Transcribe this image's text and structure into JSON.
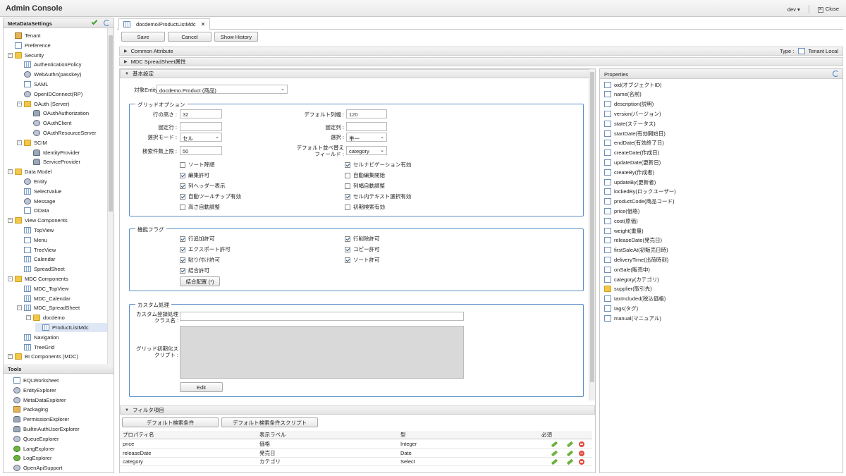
{
  "app": {
    "title": "Admin Console",
    "user": "dev",
    "close_label": "Close"
  },
  "left": {
    "header": "MetaDataSettings",
    "tree": [
      {
        "label": "Tenant",
        "depth": 0,
        "icon": "house-icon",
        "exp": ""
      },
      {
        "label": "Preference",
        "depth": 0,
        "icon": "doc-icon",
        "exp": ""
      },
      {
        "label": "Security",
        "depth": 0,
        "icon": "folder-icon",
        "exp": "-"
      },
      {
        "label": "AuthenticationPolicy",
        "depth": 1,
        "icon": "grid-icon",
        "exp": ""
      },
      {
        "label": "WebAuthn(passkey)",
        "depth": 1,
        "icon": "gear-icon",
        "exp": ""
      },
      {
        "label": "SAML",
        "depth": 1,
        "icon": "doc-icon",
        "exp": ""
      },
      {
        "label": "OpenIDConnect(RP)",
        "depth": 1,
        "icon": "gear-icon",
        "exp": ""
      },
      {
        "label": "OAuth (Server)",
        "depth": 1,
        "icon": "folder-icon",
        "exp": "-"
      },
      {
        "label": "OAuthAuthorization",
        "depth": 2,
        "icon": "person-icon",
        "exp": ""
      },
      {
        "label": "OAuthClient",
        "depth": 2,
        "icon": "gear-icon",
        "exp": ""
      },
      {
        "label": "OAuthResourceServer",
        "depth": 2,
        "icon": "gear-icon",
        "exp": ""
      },
      {
        "label": "SCIM",
        "depth": 1,
        "icon": "folder-icon",
        "exp": "-"
      },
      {
        "label": "IdentityProvider",
        "depth": 2,
        "icon": "person-icon",
        "exp": ""
      },
      {
        "label": "ServiceProvider",
        "depth": 2,
        "icon": "person-icon",
        "exp": ""
      },
      {
        "label": "Data Model",
        "depth": 0,
        "icon": "folder-icon",
        "exp": "-"
      },
      {
        "label": "Entity",
        "depth": 1,
        "icon": "gear-icon",
        "exp": ""
      },
      {
        "label": "SelectValue",
        "depth": 1,
        "icon": "grid-icon",
        "exp": ""
      },
      {
        "label": "Message",
        "depth": 1,
        "icon": "gear-icon",
        "exp": ""
      },
      {
        "label": "OData",
        "depth": 1,
        "icon": "doc-icon",
        "exp": ""
      },
      {
        "label": "View Components",
        "depth": 0,
        "icon": "folder-icon",
        "exp": "-"
      },
      {
        "label": "TopView",
        "depth": 1,
        "icon": "grid-icon",
        "exp": ""
      },
      {
        "label": "Menu",
        "depth": 1,
        "icon": "doc-icon",
        "exp": ""
      },
      {
        "label": "TreeView",
        "depth": 1,
        "icon": "doc-icon",
        "exp": ""
      },
      {
        "label": "Calendar",
        "depth": 1,
        "icon": "grid-icon",
        "exp": ""
      },
      {
        "label": "SpreadSheet",
        "depth": 1,
        "icon": "grid-icon",
        "exp": ""
      },
      {
        "label": "MDC Components",
        "depth": 0,
        "icon": "folder-icon",
        "exp": "-"
      },
      {
        "label": "MDC_TopView",
        "depth": 1,
        "icon": "grid-icon",
        "exp": ""
      },
      {
        "label": "MDC_Calendar",
        "depth": 1,
        "icon": "grid-icon",
        "exp": ""
      },
      {
        "label": "MDC_SpreadSheet",
        "depth": 1,
        "icon": "grid-icon",
        "exp": "-"
      },
      {
        "label": "docdemo",
        "depth": 2,
        "icon": "folder-icon",
        "exp": "-"
      },
      {
        "label": "ProductListMdc",
        "depth": 3,
        "icon": "grid-icon",
        "exp": "",
        "selected": true
      },
      {
        "label": "Navigation",
        "depth": 1,
        "icon": "grid-icon",
        "exp": ""
      },
      {
        "label": "TreeGrid",
        "depth": 1,
        "icon": "grid-icon",
        "exp": ""
      },
      {
        "label": "BI Components (MDC)",
        "depth": 0,
        "icon": "folder-icon",
        "exp": "-"
      }
    ],
    "tools_header": "Tools",
    "tools": [
      {
        "label": "EQLWorksheet",
        "icon": "doc-icon"
      },
      {
        "label": "EntityExplorer",
        "icon": "gear-icon"
      },
      {
        "label": "MetaDataExplorer",
        "icon": "gear-icon"
      },
      {
        "label": "Packaging",
        "icon": "house-icon"
      },
      {
        "label": "PermissionExplorer",
        "icon": "person-icon"
      },
      {
        "label": "BuiltinAuthUserExplorer",
        "icon": "person-icon"
      },
      {
        "label": "QueueExplorer",
        "icon": "gear-icon"
      },
      {
        "label": "LangExplorer",
        "icon": "green-icon"
      },
      {
        "label": "LogExplorer",
        "icon": "green-icon"
      },
      {
        "label": "OpenApiSupport",
        "icon": "gear-icon"
      }
    ]
  },
  "editor": {
    "tab_label": "docdemo/ProductListMdc",
    "save": "Save",
    "cancel": "Cancel",
    "history": "Show History",
    "common_attr": "Common Attribute",
    "type_label": "Type :",
    "type_value": "Tenant Local",
    "mdc_attr": "MDC SpreadSheet属性",
    "basic": "基本設定",
    "entity_label": "対象Entity :",
    "entity_value": "docdemo.Product (商品)",
    "grid_option": "グリッドオプション",
    "row_height_label": "行の高さ :",
    "row_height": "32",
    "default_width_label": "デフォルト列幅 :",
    "default_width": "120",
    "fixed_row_label": "固定行 :",
    "fixed_row": "",
    "fixed_col_label": "固定列 :",
    "fixed_col": "",
    "select_mode_label": "選択モード :",
    "select_mode": "セル",
    "selection_label": "選択 :",
    "selection": "単一",
    "search_limit_label": "検索件数上限 :",
    "search_limit": "50",
    "default_sort_label": "デフォルト並べ替えフィールド :",
    "default_sort": "category",
    "grid_checks": [
      {
        "label": "ソート降順",
        "on": false
      },
      {
        "label": "セルナビゲーション有効",
        "on": true
      },
      {
        "label": "編集許可",
        "on": true
      },
      {
        "label": "自動編集開始",
        "on": false
      },
      {
        "label": "列ヘッダー表示",
        "on": true
      },
      {
        "label": "列幅自動調整",
        "on": false
      },
      {
        "label": "自動ツールチップ有効",
        "on": true
      },
      {
        "label": "セル内テキスト選択有効",
        "on": true
      },
      {
        "label": "高さ自動調整",
        "on": false
      },
      {
        "label": "初期検索有効",
        "on": false
      }
    ],
    "feature_flags": "機能フラグ",
    "flag_checks": [
      {
        "label": "行追加許可",
        "on": true
      },
      {
        "label": "行削除許可",
        "on": true
      },
      {
        "label": "エクスポート許可",
        "on": true
      },
      {
        "label": "コピー許可",
        "on": true
      },
      {
        "label": "貼り付け許可",
        "on": true
      },
      {
        "label": "ソート許可",
        "on": true
      },
      {
        "label": "結合許可",
        "on": true
      }
    ],
    "merge_btn": "結合配置 (*)",
    "custom": "カスタム処理",
    "custom_class_label": "カスタム登録処理クラス名 :",
    "custom_class": "",
    "grid_script_label": "グリッド初期化スクリプト :",
    "edit_btn": "Edit",
    "filter": "フィルタ項目",
    "filter_btn1": "デフォルト検索条件",
    "filter_btn2": "デフォルト検索条件スクリプト",
    "cols": {
      "prop": "プロパティ名",
      "label": "表示ラベル",
      "type": "型",
      "req": "必須"
    },
    "rows": [
      {
        "prop": "price",
        "label": "価格",
        "type": "Integer"
      },
      {
        "prop": "releaseDate",
        "label": "発売日",
        "type": "Date"
      },
      {
        "prop": "category",
        "label": "カテゴリ",
        "type": "Select"
      }
    ]
  },
  "properties": {
    "header": "Properties",
    "items": [
      {
        "label": "oid(オブジェクトID)",
        "icon": "doc-icon"
      },
      {
        "label": "name(名前)",
        "icon": "doc-icon"
      },
      {
        "label": "description(説明)",
        "icon": "doc-icon"
      },
      {
        "label": "version(バージョン)",
        "icon": "doc-icon"
      },
      {
        "label": "state(ステータス)",
        "icon": "doc-icon"
      },
      {
        "label": "startDate(有効開始日)",
        "icon": "doc-icon"
      },
      {
        "label": "endDate(有効終了日)",
        "icon": "doc-icon"
      },
      {
        "label": "createDate(作成日)",
        "icon": "doc-icon"
      },
      {
        "label": "updateDate(更新日)",
        "icon": "doc-icon"
      },
      {
        "label": "createBy(作成者)",
        "icon": "doc-icon"
      },
      {
        "label": "updateBy(更新者)",
        "icon": "doc-icon"
      },
      {
        "label": "lockedBy(ロックユーザー)",
        "icon": "doc-icon"
      },
      {
        "label": "productCode(商品コード)",
        "icon": "doc-icon"
      },
      {
        "label": "price(価格)",
        "icon": "doc-icon"
      },
      {
        "label": "cost(原価)",
        "icon": "doc-icon"
      },
      {
        "label": "weight(重量)",
        "icon": "doc-icon"
      },
      {
        "label": "releaseDate(発売日)",
        "icon": "doc-icon"
      },
      {
        "label": "firstSaleAt(初販売日時)",
        "icon": "doc-icon"
      },
      {
        "label": "deliveryTime(出荷時刻)",
        "icon": "doc-icon"
      },
      {
        "label": "onSale(販売中)",
        "icon": "doc-icon"
      },
      {
        "label": "category(カテゴリ)",
        "icon": "doc-icon"
      },
      {
        "label": "supplier(取引先)",
        "icon": "folder-icon"
      },
      {
        "label": "taxIncluded(税込価格)",
        "icon": "doc-icon"
      },
      {
        "label": "tags(タグ)",
        "icon": "doc-icon"
      },
      {
        "label": "manual(マニュアル)",
        "icon": "doc-icon"
      }
    ]
  }
}
